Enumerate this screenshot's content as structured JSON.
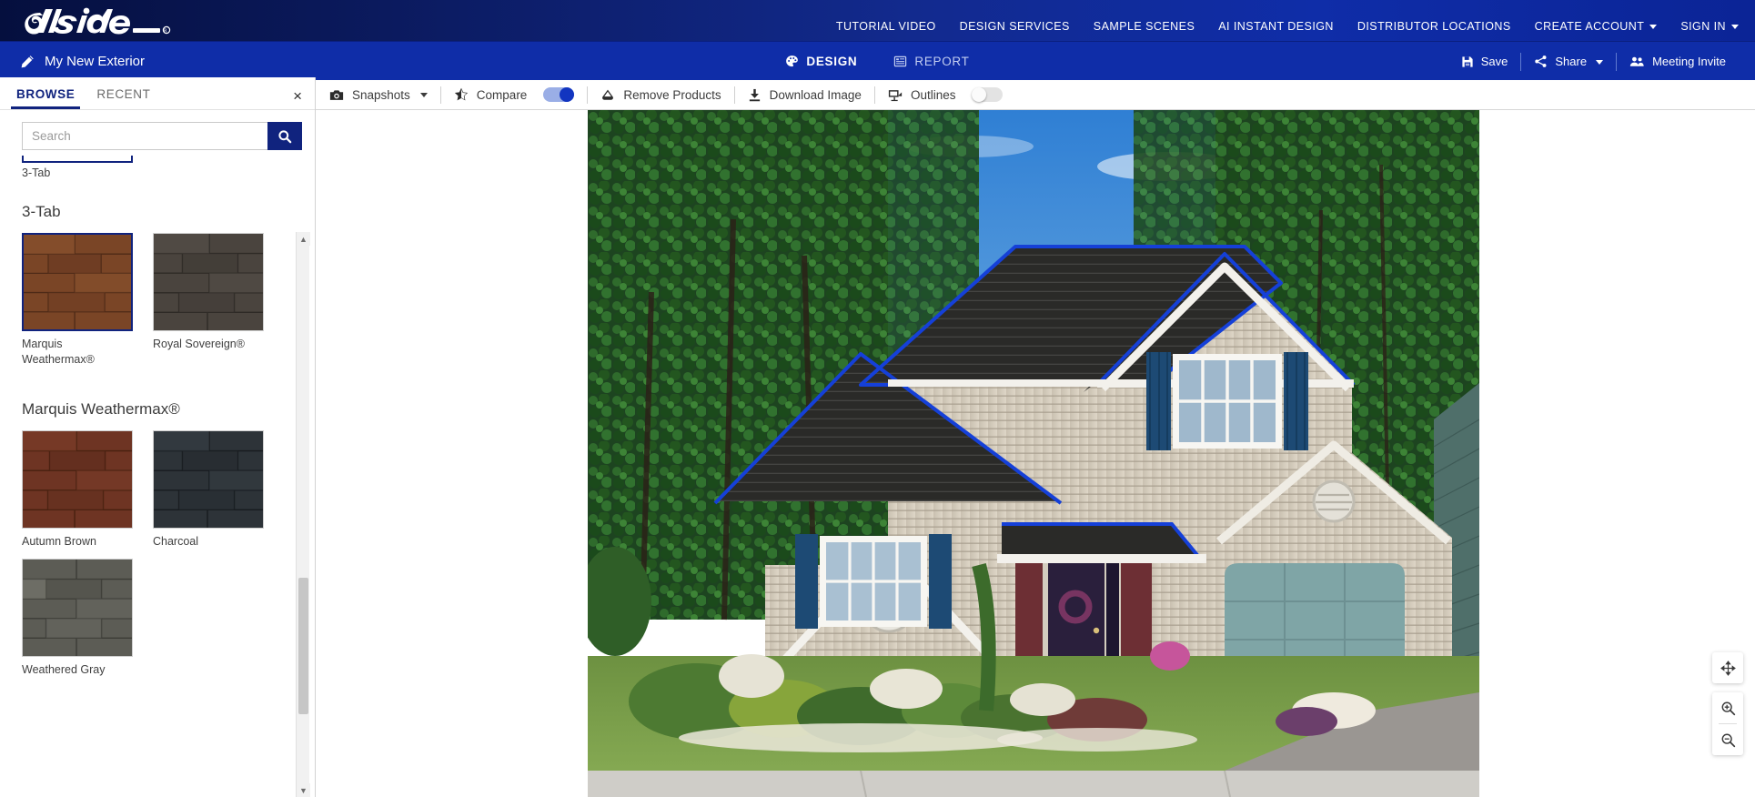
{
  "brand": {
    "name": "Alside",
    "registered": "®"
  },
  "topnav": {
    "links": [
      {
        "label": "TUTORIAL VIDEO",
        "dropdown": false
      },
      {
        "label": "DESIGN SERVICES",
        "dropdown": false
      },
      {
        "label": "SAMPLE SCENES",
        "dropdown": false
      },
      {
        "label": "AI INSTANT DESIGN",
        "dropdown": false
      },
      {
        "label": "DISTRIBUTOR LOCATIONS",
        "dropdown": false
      },
      {
        "label": "CREATE ACCOUNT",
        "dropdown": true
      },
      {
        "label": "SIGN IN",
        "dropdown": true
      }
    ]
  },
  "subbar": {
    "project_title": "My New Exterior",
    "tabs": [
      {
        "label": "DESIGN",
        "icon": "palette-icon",
        "active": true
      },
      {
        "label": "REPORT",
        "icon": "report-icon",
        "active": false
      }
    ],
    "actions": [
      {
        "label": "Save",
        "icon": "save-icon",
        "dropdown": false
      },
      {
        "label": "Share",
        "icon": "share-icon",
        "dropdown": true
      },
      {
        "label": "Meeting Invite",
        "icon": "people-icon",
        "dropdown": false
      }
    ]
  },
  "toolbar": {
    "items": [
      {
        "label": "Snapshots",
        "icon": "camera-icon",
        "dropdown": true,
        "toggle": null
      },
      {
        "label": "Compare",
        "icon": "star-icon",
        "dropdown": false,
        "toggle": "on"
      },
      {
        "label": "Remove Products",
        "icon": "eraser-icon",
        "dropdown": false,
        "toggle": null
      },
      {
        "label": "Download Image",
        "icon": "download-icon",
        "dropdown": false,
        "toggle": null
      },
      {
        "label": "Outlines",
        "icon": "outlines-icon",
        "dropdown": false,
        "toggle": "off"
      }
    ]
  },
  "sidebar": {
    "tabs": [
      {
        "label": "BROWSE",
        "active": true
      },
      {
        "label": "RECENT",
        "active": false
      }
    ],
    "close_label": "×",
    "search": {
      "value": "",
      "placeholder": "Search"
    },
    "partial_item": {
      "label": "3-Tab",
      "selected": true
    },
    "groups": [
      {
        "title": "3-Tab",
        "items": [
          {
            "label": "Marquis Weathermax®",
            "selected": true,
            "color": "#7a4526",
            "color2": "#8c5430",
            "color3": "#633620"
          },
          {
            "label": "Royal Sovereign®",
            "selected": false,
            "color": "#4a443e",
            "color2": "#565049",
            "color3": "#3c3732"
          }
        ]
      },
      {
        "title": "Marquis Weathermax®",
        "items": [
          {
            "label": "Autumn Brown",
            "selected": false,
            "color": "#6e3423",
            "color2": "#7d3d2a",
            "color3": "#5a2a1c"
          },
          {
            "label": "Charcoal",
            "selected": false,
            "color": "#2d3338",
            "color2": "#383f45",
            "color3": "#23282c"
          },
          {
            "label": "Weathered Gray",
            "selected": false,
            "color": "#5c5c55",
            "color2": "#6b6b63",
            "color3": "#4d4d47"
          }
        ]
      }
    ]
  },
  "canvas": {
    "scene_description": "Two-story suburban home front elevation with tan vinyl siding, dark shingle roof outlined in blue selection, blue shutters, attached two-car garage with teal door, landscaped front garden and lawn",
    "zoom_tools": [
      {
        "name": "pan-tool",
        "icon": "move-icon"
      },
      {
        "name": "zoom-in",
        "icon": "zoom-in-icon"
      },
      {
        "name": "zoom-out",
        "icon": "zoom-out-icon"
      }
    ]
  },
  "colors": {
    "brand_navy": "#10237e",
    "brand_blue": "#0f2da8",
    "accent_toggle": "#1235c0",
    "selection_outline": "#1540d8"
  }
}
